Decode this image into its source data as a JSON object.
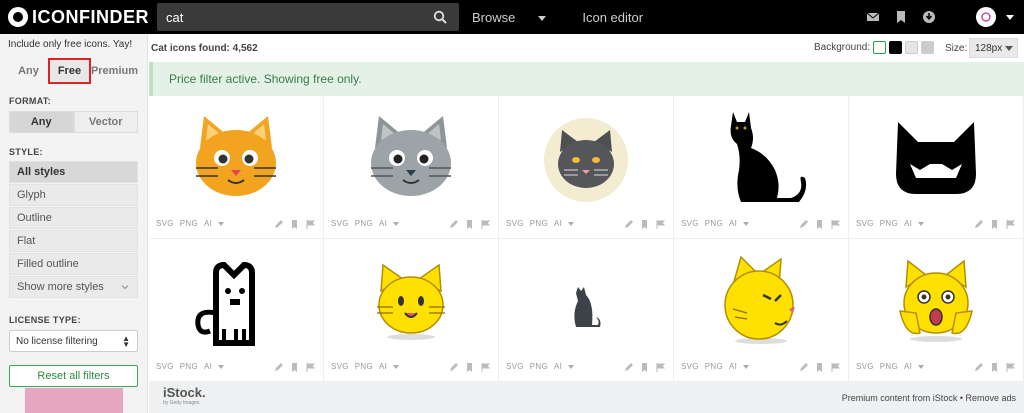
{
  "brand": {
    "name": "ICONFINDER"
  },
  "search": {
    "value": "cat",
    "placeholder": ""
  },
  "nav": {
    "browse": "Browse",
    "icon_editor": "Icon editor"
  },
  "sidebar": {
    "promo": "Include only free icons. Yay!",
    "price": {
      "any": "Any",
      "free": "Free",
      "premium": "Premium",
      "selected": "Free"
    },
    "format_label": "FORMAT:",
    "format": {
      "any": "Any",
      "vector": "Vector",
      "selected": "Any"
    },
    "style_label": "STYLE:",
    "styles": [
      {
        "label": "All styles",
        "selected": true
      },
      {
        "label": "Glyph",
        "selected": false
      },
      {
        "label": "Outline",
        "selected": false
      },
      {
        "label": "Flat",
        "selected": false
      },
      {
        "label": "Filled outline",
        "selected": false
      },
      {
        "label": "Show more styles",
        "selected": false
      }
    ],
    "license_label": "LICENSE TYPE:",
    "license_value": "No license filtering",
    "reset_label": "Reset all filters"
  },
  "main": {
    "found": "Cat icons found: 4,562",
    "background_label": "Background:",
    "backgrounds": [
      "#ffffff",
      "#000000",
      "#e6e6e6",
      "#cccccc"
    ],
    "size_label": "Size:",
    "size_value": "128px",
    "banner": "Price filter active. Showing free only.",
    "icons": [
      {
        "formats": [
          "SVG",
          "PNG",
          "AI"
        ]
      },
      {
        "formats": [
          "SVG",
          "PNG",
          "AI"
        ]
      },
      {
        "formats": [
          "SVG",
          "PNG",
          "AI"
        ]
      },
      {
        "formats": [
          "SVG",
          "PNG",
          "AI"
        ]
      },
      {
        "formats": [
          "SVG",
          "PNG",
          "AI"
        ]
      },
      {
        "formats": [
          "SVG",
          "PNG",
          "AI"
        ]
      },
      {
        "formats": [
          "SVG",
          "PNG",
          "AI"
        ]
      },
      {
        "formats": [
          "SVG",
          "PNG",
          "AI"
        ]
      },
      {
        "formats": [
          "SVG",
          "PNG",
          "AI"
        ]
      },
      {
        "formats": [
          "SVG",
          "PNG",
          "AI"
        ]
      }
    ],
    "footer": {
      "istock": "iStock.",
      "istock_sub": "by Getty Images",
      "premium_text": "Premium content from iStock • Remove ads"
    }
  },
  "colors": {
    "accent_green": "#3aa757",
    "banner_bg": "#e4f1e6",
    "highlight_red": "#dd2222"
  }
}
